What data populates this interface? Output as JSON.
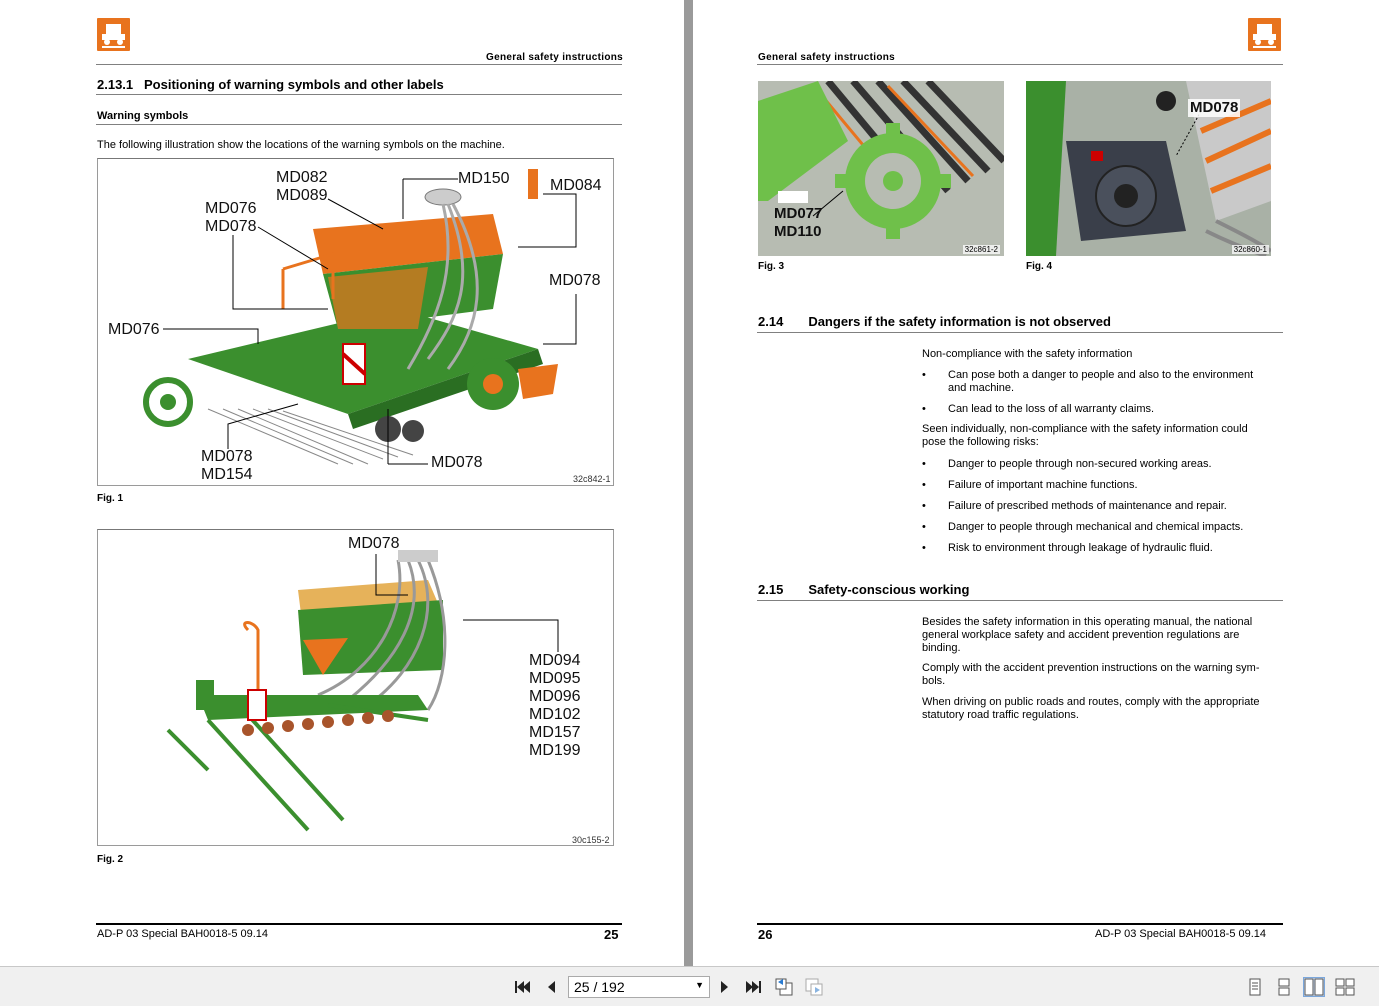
{
  "header_left": "General safety instructions",
  "header_right": "General safety instructions",
  "section_2_13_1": {
    "num": "2.13.1",
    "title": "Positioning of warning symbols and other labels"
  },
  "warning_symbols": "Warning symbols",
  "intro": "The following illustration show the locations of the warning symbols on the machine.",
  "fig1": {
    "label": "Fig. 1",
    "code": "32c842-1",
    "callouts": {
      "md082": "MD082",
      "md089": "MD089",
      "md150": "MD150",
      "md084": "MD084",
      "md076a": "MD076",
      "md078a": "MD078",
      "md078b": "MD078",
      "md076b": "MD076",
      "md078c": "MD078",
      "md154": "MD154",
      "md078d": "MD078"
    }
  },
  "fig2": {
    "label": "Fig. 2",
    "code": "30c155-2",
    "callouts": {
      "md078": "MD078",
      "list": [
        "MD094",
        "MD095",
        "MD096",
        "MD102",
        "MD157",
        "MD199"
      ]
    }
  },
  "fig3": {
    "label": "Fig. 3",
    "code": "32c861-2",
    "md077": "MD077",
    "md110": "MD110"
  },
  "fig4": {
    "label": "Fig. 4",
    "code": "32c860-1",
    "md078": "MD078"
  },
  "section_2_14": {
    "num": "2.14",
    "title": "Dangers if the safety information is not observed",
    "p1": "Non-compliance with the safety information",
    "b1_l1": "Can pose both a danger to people and also to the environment",
    "b1_l2": "and machine.",
    "b2": "Can lead to the loss of all warranty claims.",
    "p2_l1": "Seen individually, non-compliance with the safety information could",
    "p2_l2": "pose the following risks:",
    "b3": "Danger to people through non-secured working areas.",
    "b4": "Failure of important machine functions.",
    "b5": "Failure of prescribed methods of maintenance and repair.",
    "b6": "Danger to people through mechanical and chemical impacts.",
    "b7": "Risk to environment through leakage of hydraulic fluid."
  },
  "section_2_15": {
    "num": "2.15",
    "title": "Safety-conscious working",
    "p1_l1": "Besides the safety information in this operating manual, the national",
    "p1_l2": "general workplace safety and accident prevention regulations are",
    "p1_l3": "binding.",
    "p2_l1": "Comply with the accident prevention instructions on the warning sym-",
    "p2_l2": "bols.",
    "p3_l1": "When driving on public roads and routes, comply with the appropriate",
    "p3_l2": "statutory road traffic regulations."
  },
  "footer_left": {
    "doc": "AD-P 03 Special  BAH0018-5  09.14",
    "page": "25"
  },
  "footer_right": {
    "doc": "AD-P 03 Special  BAH0018-5  09.14",
    "page": "26"
  },
  "toolbar": {
    "page_indicator": "25 / 192"
  },
  "colors": {
    "brand_orange": "#e8731e",
    "machine_green": "#3b8f2e",
    "toolbar_bg": "#f0f0f0"
  }
}
